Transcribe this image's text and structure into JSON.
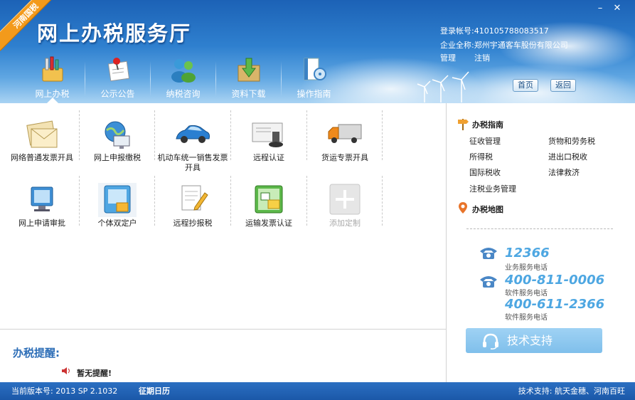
{
  "header": {
    "ribbon": "河南国税",
    "title": "网上办税服务厅",
    "account_label": "登录帐号:",
    "account_value": "410105788083517",
    "company_label": "企业全称:",
    "company_value": "郑州宇通客车股份有限公司",
    "manage": "管理",
    "logout": "注销",
    "home_btn": "首页",
    "back_btn": "返回"
  },
  "nav": [
    {
      "label": "网上办税",
      "icon": "toolbox-icon",
      "active": true
    },
    {
      "label": "公示公告",
      "icon": "notice-pin-icon"
    },
    {
      "label": "纳税咨询",
      "icon": "people-chat-icon"
    },
    {
      "label": "资料下载",
      "icon": "download-box-icon"
    },
    {
      "label": "操作指南",
      "icon": "guide-book-icon"
    }
  ],
  "tiles": [
    {
      "label": "网络普通发票开具",
      "icon": "invoice-envelope-icon"
    },
    {
      "label": "网上申报缴税",
      "icon": "globe-computer-icon"
    },
    {
      "label": "机动车统一销售发票开具",
      "icon": "car-icon"
    },
    {
      "label": "远程认证",
      "icon": "stamp-certificate-icon"
    },
    {
      "label": "货运专票开具",
      "icon": "truck-icon"
    },
    {
      "label": "网上申请审批",
      "icon": "monitor-icon"
    },
    {
      "label": "个体双定户",
      "icon": "individual-board-icon"
    },
    {
      "label": "远程抄报税",
      "icon": "document-pencil-icon"
    },
    {
      "label": "运输发票认证",
      "icon": "transport-invoice-icon"
    },
    {
      "label": "添加定制",
      "icon": "add-plus-icon"
    }
  ],
  "reminder": {
    "title": "办税提醒:",
    "text": "暂无提醒!"
  },
  "guide": {
    "title": "办税指南",
    "links": [
      "征收管理",
      "货物和劳务税",
      "所得税",
      "进出口税收",
      "国际税收",
      "法律救济",
      "注税业务管理"
    ],
    "map_title": "办税地图"
  },
  "phones": [
    {
      "number": "12366",
      "desc": "业务服务电话"
    },
    {
      "number": "400-811-0006",
      "desc": "软件服务电话"
    },
    {
      "number": "400-611-2366",
      "desc": "软件服务电话"
    }
  ],
  "support_btn": "技术支持",
  "footer": {
    "version": "当前版本号: 2013 SP 2.1032",
    "calendar": "征期日历",
    "support": "技术支持: 航天金穗、河南百旺"
  },
  "colors": {
    "header_blue": "#2f80cf",
    "ribbon_orange": "#f39a1b",
    "phone_blue": "#4ea7e2",
    "footer_blue": "#1b58a8"
  }
}
